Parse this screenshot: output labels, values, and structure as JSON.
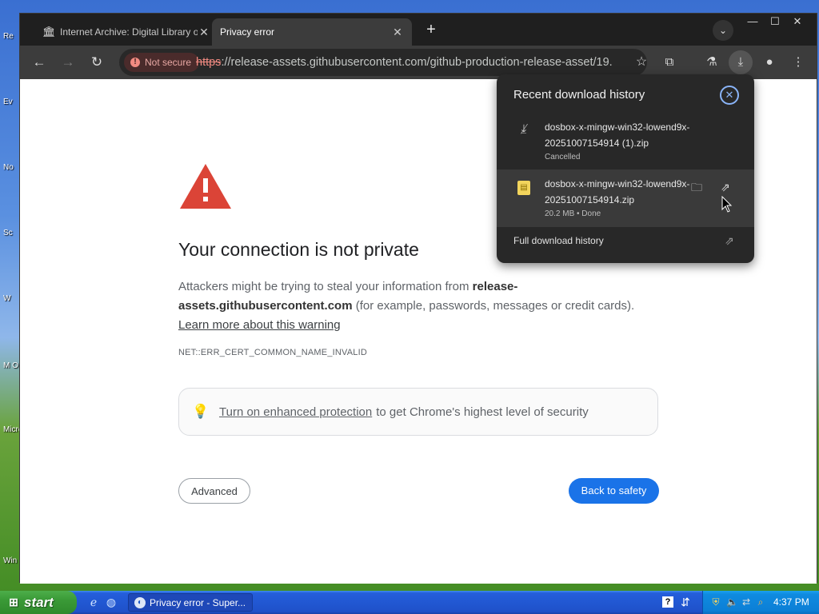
{
  "desktop": {
    "labels": [
      "Re",
      "Ev",
      "No",
      "Sc",
      "W",
      "M\nO",
      "Micro Stu",
      "Win"
    ]
  },
  "browser": {
    "tabs": [
      {
        "title": "Internet Archive: Digital Library of",
        "favicon": "archive-icon",
        "active": false
      },
      {
        "title": "Privacy error",
        "favicon": "none",
        "active": true
      }
    ],
    "new_tab_glyph": "+",
    "window_controls": {
      "minimize": "—",
      "maximize": "☐",
      "close": "✕"
    },
    "toolbar": {
      "security_chip": "Not secure",
      "url_scheme": "https",
      "url_rest": "://release-assets.githubusercontent.com/github-production-release-asset/19..."
    }
  },
  "page": {
    "heading": "Your connection is not private",
    "body_prefix": "Attackers might be trying to steal your information from ",
    "body_domain": "release-assets.githubusercontent.com",
    "body_suffix": " (for example, passwords, messages or credit cards).",
    "learn_more": "Learn more about this warning",
    "error_code": "NET::ERR_CERT_COMMON_NAME_INVALID",
    "protection_link": "Turn on enhanced protection",
    "protection_text": "to get Chrome's highest level of security",
    "advanced_button": "Advanced",
    "safety_button": "Back to safety"
  },
  "downloads": {
    "title": "Recent download history",
    "items": [
      {
        "name": "dosbox-x-mingw-win32-lowend9x-20251007154914 (1).zip",
        "status": "Cancelled"
      },
      {
        "name": "dosbox-x-mingw-win32-lowend9x-20251007154914.zip",
        "status": "20.2 MB • Done"
      }
    ],
    "full_history": "Full download history"
  },
  "taskbar": {
    "start_label": "start",
    "task_button": "Privacy error - Super...",
    "clock": "4:37 PM"
  },
  "colors": {
    "accent_blue": "#1a73e8",
    "warning_red": "#db4437",
    "not_secure": "#f28b82"
  }
}
